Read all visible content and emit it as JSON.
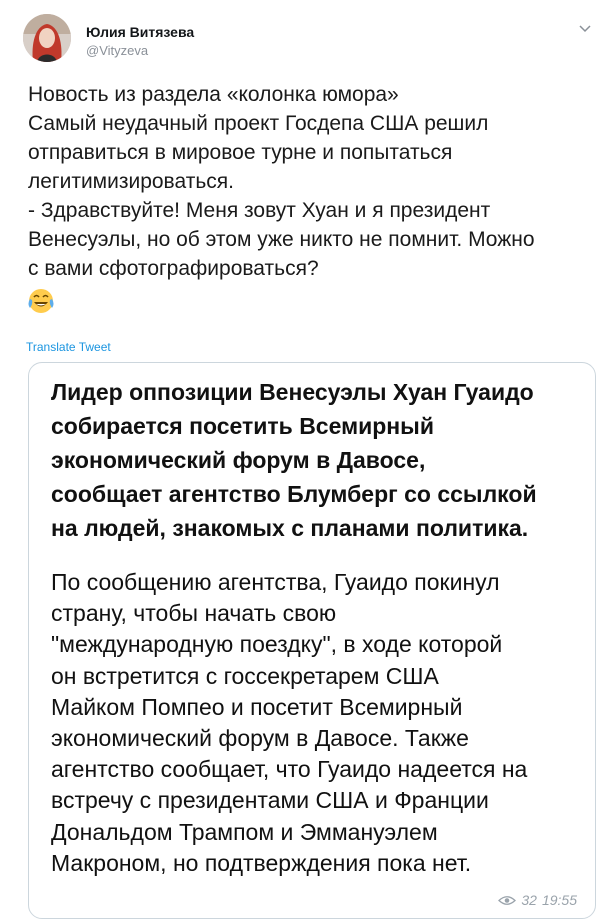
{
  "author": {
    "name": "Юлия Витязева",
    "handle": "@Vityzeva"
  },
  "tweet": {
    "lines": [
      "Новость из раздела «колонка юмора»",
      "Самый неудачный проект Госдепа США решил",
      "отправиться в мировое турне и попытаться",
      "легитимизироваться.",
      "- Здравствуйте! Меня зовут Хуан и я президент",
      "Венесуэлы, но об этом уже никто не помнит. Можно",
      "с вами сфотографироваться?"
    ],
    "emoji_icon": "face-with-tears-of-joy-icon",
    "translate_label": "Translate Tweet"
  },
  "card": {
    "headline_lines": [
      "Лидер оппозиции Венесуэлы Хуан Гуаидо",
      "собирается посетить Всемирный",
      "экономический форум в Давосе,",
      "сообщает агентство Блумберг со ссылкой",
      "на людей, знакомых с планами политика."
    ],
    "body_lines": [
      "По сообщению агентства, Гуаидо покинул",
      "страну, чтобы начать свою",
      "\"международную поездку\", в ходе которой",
      "он встретится с госсекретарем США",
      "Майком Помпео и посетит Всемирный",
      "экономический форум в Давосе. Также",
      "агентство сообщает, что Гуаидо надеется на",
      "встречу с президентами США и Франции",
      "Дональдом Трампом и Эммануэлем",
      "Макроном, но подтверждения пока нет."
    ],
    "views": "32",
    "time": "19:55"
  },
  "colors": {
    "link": "#1b95e0",
    "border": "#ccd6dd",
    "muted": "#8a9098"
  }
}
